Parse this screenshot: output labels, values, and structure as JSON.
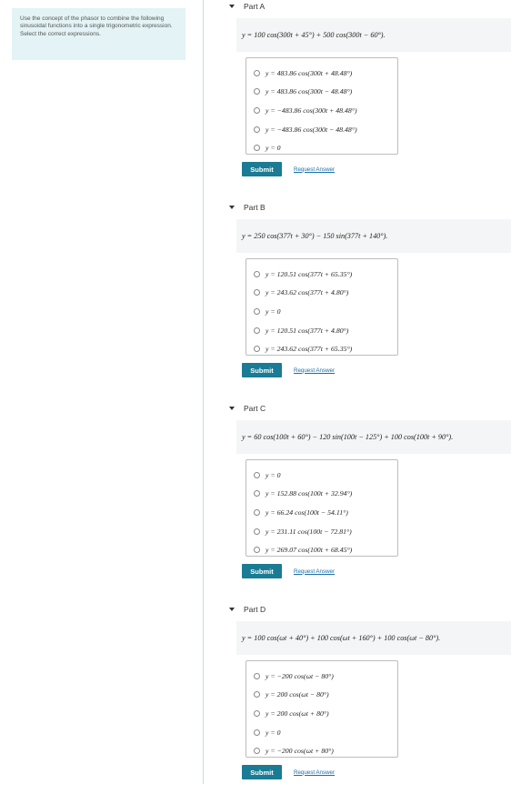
{
  "intro": {
    "text": "Use the concept of the phasor to combine the following sinusoidal functions into a single trigonometric expression. Select the correct expressions."
  },
  "labels": {
    "submit": "Submit",
    "request_answer": "Request Answer"
  },
  "parts": [
    {
      "title": "Part A",
      "question": "y = 100 cos(300t + 45°) + 500 cos(300t − 60°).",
      "options": [
        "y = 483.86 cos(300t + 48.48°)",
        "y = 483.86 cos(300t − 48.48°)",
        "y = −483.86 cos(300t + 48.48°)",
        "y = −483.86 cos(300t − 48.48°)",
        "y = 0"
      ]
    },
    {
      "title": "Part B",
      "question": "y = 250 cos(377t + 30°) − 150 sin(377t + 140°).",
      "options": [
        "y = 120.51 cos(377t + 65.35°)",
        "y = 243.62 cos(377t + 4.80°)",
        "y = 0",
        "y = 120.51 cos(377t + 4.80°)",
        "y = 243.62 cos(377t + 65.35°)"
      ]
    },
    {
      "title": "Part C",
      "question": "y = 60 cos(100t + 60°) − 120 sin(100t − 125°) + 100 cos(100t + 90°).",
      "options": [
        "y = 0",
        "y = 152.88 cos(100t + 32.94°)",
        "y = 66.24 cos(100t − 54.11°)",
        "y = 231.11 cos(100t − 72.81°)",
        "y = 269.07 cos(100t + 68.45°)"
      ]
    },
    {
      "title": "Part D",
      "question": "y = 100 cos(ωt + 40°) + 100 cos(ωt + 160°) + 100 cos(ωt − 80°).",
      "options": [
        "y = −200 cos(ωt − 80°)",
        "y = 200 cos(ωt − 80°)",
        "y = 200 cos(ωt + 80°)",
        "y = 0",
        "y = −200 cos(ωt + 80°)"
      ]
    }
  ]
}
